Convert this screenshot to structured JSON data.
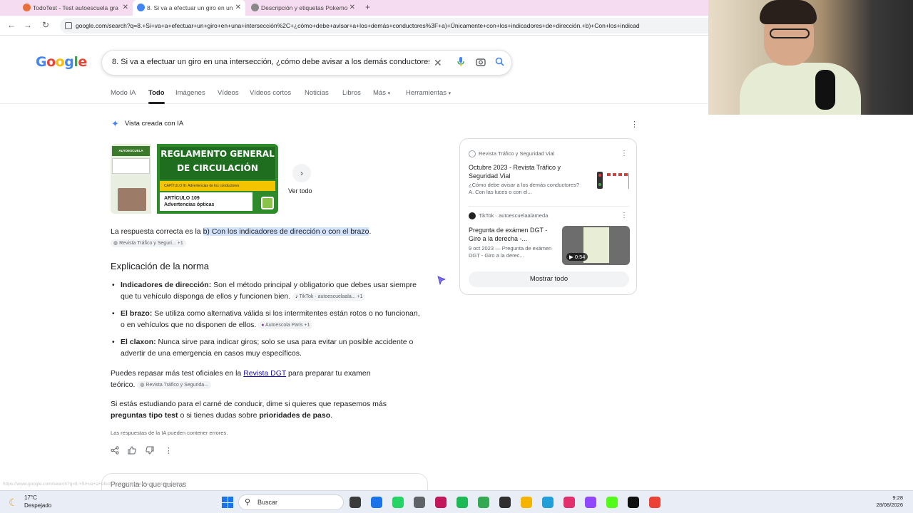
{
  "browser": {
    "tabs": [
      {
        "title": "TodoTest - Test autoescuela gra",
        "color": "#e8703a"
      },
      {
        "title": "8. Si va a efectuar un giro en un",
        "color": "#4285f4"
      },
      {
        "title": "Descripción y etiquetas Pokemo",
        "color": "#888888"
      }
    ],
    "new_tab": "+",
    "url": "google.com/search?q=8.+Si+va+a+efectuar+un+giro+en+una+intersección%2C+¿cómo+debe+avisar+a+los+demás+conductores%3F+a)+Únicamente+con+los+indicadores+de+dirección.+b)+Con+los+indicad"
  },
  "search": {
    "logo": "Google",
    "query": "8. Si va a efectuar un giro en una intersección, ¿cómo debe avisar a los demás conductores?",
    "tabs": [
      "Modo IA",
      "Todo",
      "Imágenes",
      "Vídeos",
      "Vídeos cortos",
      "Noticias",
      "Libros",
      "Más",
      "Herramientas"
    ]
  },
  "ai": {
    "title": "Vista creada con IA",
    "thumb_heading": "REGLAMENTO GENERAL DE CIRCULACIÓN",
    "thumb_subtitle": "CAPÍTULO III. Advertencias de los conductores",
    "thumb_card_line1": "ARTÍCULO 109",
    "thumb_card_line2": "Advertencias ópticas",
    "thumb_left_label": "AUTOESCUELA ALAMEDA",
    "ver_todo": "Ver todo",
    "answer_prefix": "La respuesta correcta es la",
    "answer_highlight": "b) Con los indicadores de dirección o con el brazo",
    "answer_chip": "Revista Tráfico y Seguri... +1",
    "section_heading": "Explicación de la norma",
    "bullets": [
      {
        "term": "Indicadores de dirección:",
        "text": "Son el método principal y obligatorio que debes usar siempre que tu vehículo disponga de ellos y funcionen bien.",
        "chip": "TikTok · autoescuelaala... +1"
      },
      {
        "term": "El brazo:",
        "text": "Se utiliza como alternativa válida si los intermitentes están rotos o no funcionan, o en vehículos que no disponen de ellos.",
        "chip": "Autoescola Paris +1"
      },
      {
        "term": "El claxon:",
        "text": "Nunca sirve para indicar giros; solo se usa para evitar un posible accidente o advertir de una emergencia en casos muy específicos.",
        "chip": ""
      }
    ],
    "para1_a": "Puedes repasar más test oficiales en la",
    "para1_link": "Revista DGT",
    "para1_b": "para preparar tu examen teórico.",
    "para1_chip": "Revista Tráfico y Segurida...",
    "para2_a": "Si estás estudiando para el carné de conducir, dime si quieres que repasemos más",
    "para2_b": "preguntas tipo test",
    "para2_c": "o si tienes dudas sobre",
    "para2_d": "prioridades de paso",
    "disclaimer": "Las respuestas de la IA pueden contener errores.",
    "ask_placeholder": "Pregunta lo que quieras"
  },
  "sources": [
    {
      "site": "Revista Tráfico y Seguridad Vial",
      "title": "Octubre 2023 - Revista Tráfico y Seguridad Vial",
      "snippet": "¿Cómo debe avisar a los demás conductores? A. Con las luces o con el..."
    },
    {
      "site": "TikTok",
      "site_sub": "autoescuelaalameda",
      "title": "Pregunta de exámen DGT - Giro a la derecha -...",
      "snippet": "9 oct 2023 — Pregunta de exámen DGT - Giro a la derec...",
      "duration": "0:54"
    }
  ],
  "show_all": "Mostrar todo",
  "status_url": "https://www.google.com/search?q=8.+Si+va+a+efectuar+un+giro+en+una+intersección...",
  "taskbar": {
    "temp": "17°C",
    "condition": "Despejado",
    "search_label": "Buscar",
    "time": "9:28",
    "date": "28/08/2026",
    "app_colors": [
      "#3b3b3b",
      "#1a73e8",
      "#25d366",
      "#5f6368",
      "#c2185b",
      "#1db954",
      "#34a853",
      "#2f2f2f",
      "#f4b400",
      "#229ed9",
      "#e1306c",
      "#9146ff",
      "#53fc18",
      "#111111",
      "#ea4335"
    ]
  }
}
